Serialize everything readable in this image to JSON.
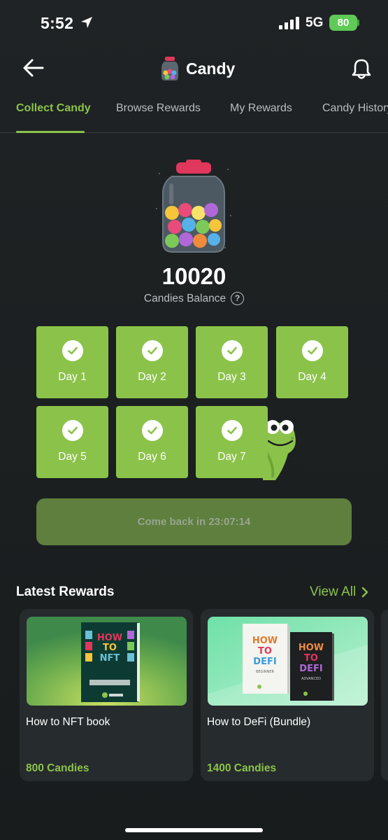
{
  "status_bar": {
    "time": "5:52",
    "network": "5G",
    "battery": "80"
  },
  "header": {
    "title": "Candy"
  },
  "tabs": [
    {
      "label": "Collect Candy",
      "active": true
    },
    {
      "label": "Browse Rewards",
      "active": false
    },
    {
      "label": "My Rewards",
      "active": false
    },
    {
      "label": "Candy History",
      "active": false
    }
  ],
  "balance": {
    "value": "10020",
    "label": "Candies Balance",
    "help": "?"
  },
  "days": [
    {
      "label": "Day 1",
      "checked": true
    },
    {
      "label": "Day 2",
      "checked": true
    },
    {
      "label": "Day 3",
      "checked": true
    },
    {
      "label": "Day 4",
      "checked": true
    },
    {
      "label": "Day 5",
      "checked": true
    },
    {
      "label": "Day 6",
      "checked": true
    },
    {
      "label": "Day 7",
      "checked": true
    }
  ],
  "comeback": {
    "label": "Come back in 23:07:14"
  },
  "latest_rewards": {
    "title": "Latest Rewards",
    "view_all": "View All",
    "items": [
      {
        "name": "How to NFT book",
        "price": "800 Candies",
        "book_lines": [
          "HOW",
          "TO",
          "NFT"
        ],
        "publisher": "CoinGecko"
      },
      {
        "name": "How to DeFi (Bundle)",
        "price": "1400 Candies",
        "book_lines": [
          "HOW",
          "TO",
          "DEFI"
        ],
        "book_subtitles": [
          "BEGINNER",
          "ADVANCED"
        ],
        "publisher": "CoinGecko"
      }
    ]
  },
  "colors": {
    "accent": "#8bc34a",
    "background": "#1f2325",
    "card": "#262b2d"
  }
}
